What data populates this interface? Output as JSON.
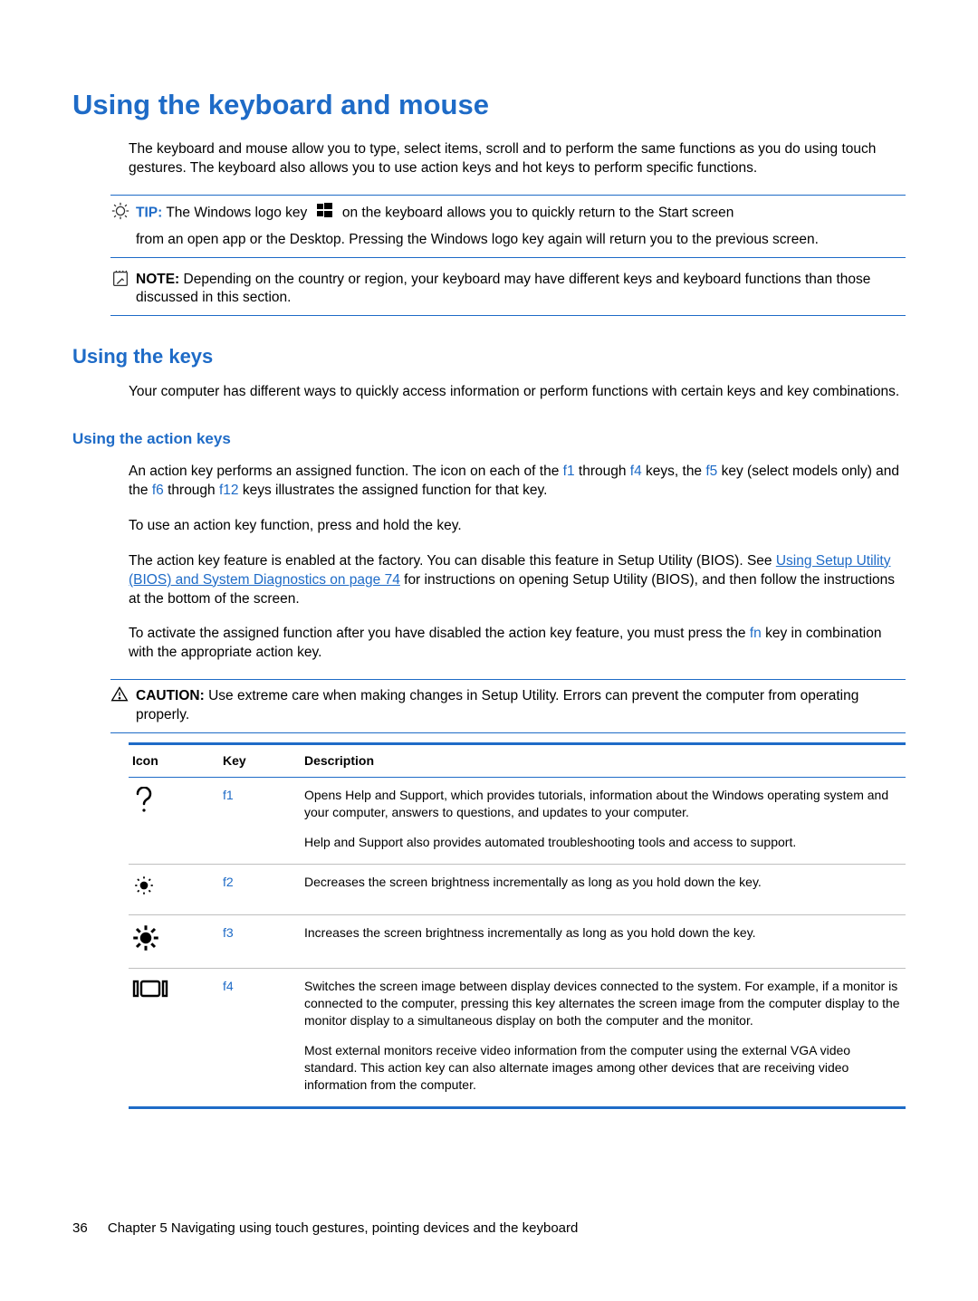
{
  "heading1": "Using the keyboard and mouse",
  "intro": "The keyboard and mouse allow you to type, select items, scroll and to perform the same functions as you do using touch gestures. The keyboard also allows you to use action keys and hot keys to perform specific functions.",
  "tip": {
    "label": "TIP:",
    "part1": "The Windows logo key",
    "part2": "on the keyboard allows you to quickly return to the Start screen",
    "line2": "from an open app or the Desktop. Pressing the Windows logo key again will return you to the previous screen."
  },
  "note": {
    "label": "NOTE:",
    "text": "Depending on the country or region, your keyboard may have different keys and keyboard functions than those discussed in this section."
  },
  "heading2": "Using the keys",
  "keys_intro": "Your computer has different ways to quickly access information or perform functions with certain keys and key combinations.",
  "heading3": "Using the action keys",
  "action_p1_a": "An action key performs an assigned function. The icon on each of the ",
  "action_p1_b": " through ",
  "action_p1_c": " keys, the ",
  "action_p1_d": " key (select models only) and the ",
  "action_p1_e": " through ",
  "action_p1_f": " keys illustrates the assigned function for that key.",
  "keys_inline": {
    "f1": "f1",
    "f4": "f4",
    "f5": "f5",
    "f6": "f6",
    "f12": "f12",
    "fn": "fn"
  },
  "action_p2": "To use an action key function, press and hold the key.",
  "action_p3_a": "The action key feature is enabled at the factory. You can disable this feature in Setup Utility (BIOS). See ",
  "action_p3_link": "Using Setup Utility (BIOS) and System Diagnostics on page 74",
  "action_p3_b": " for instructions on opening Setup Utility (BIOS), and then follow the instructions at the bottom of the screen.",
  "action_p4_a": "To activate the assigned function after you have disabled the action key feature, you must press the ",
  "action_p4_b": " key in combination with the appropriate action key.",
  "caution": {
    "label": "CAUTION:",
    "text": "Use extreme care when making changes in Setup Utility. Errors can prevent the computer from operating properly."
  },
  "table": {
    "headers": {
      "icon": "Icon",
      "key": "Key",
      "desc": "Description"
    },
    "rows": [
      {
        "icon": "help-icon",
        "key": "f1",
        "desc": [
          "Opens Help and Support, which provides tutorials, information about the Windows operating system and your computer, answers to questions, and updates to your computer.",
          "Help and Support also provides automated troubleshooting tools and access to support."
        ]
      },
      {
        "icon": "brightness-down-icon",
        "key": "f2",
        "desc": [
          "Decreases the screen brightness incrementally as long as you hold down the key."
        ]
      },
      {
        "icon": "brightness-up-icon",
        "key": "f3",
        "desc": [
          "Increases the screen brightness incrementally as long as you hold down the key."
        ]
      },
      {
        "icon": "switch-display-icon",
        "key": "f4",
        "desc": [
          "Switches the screen image between display devices connected to the system. For example, if a monitor is connected to the computer, pressing this key alternates the screen image from the computer display to the monitor display to a simultaneous display on both the computer and the monitor.",
          "Most external monitors receive video information from the computer using the external VGA video standard. This action key can also alternate images among other devices that are receiving video information from the computer."
        ]
      }
    ]
  },
  "footer": {
    "page": "36",
    "chapter": "Chapter 5   Navigating using touch gestures, pointing devices and the keyboard"
  }
}
